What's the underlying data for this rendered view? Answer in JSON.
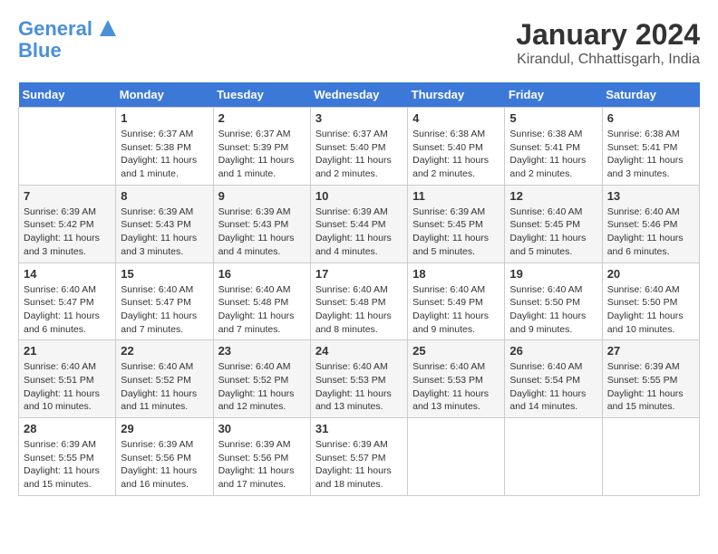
{
  "logo": {
    "line1": "General",
    "line2": "Blue"
  },
  "title": "January 2024",
  "location": "Kirandul, Chhattisgarh, India",
  "days_of_week": [
    "Sunday",
    "Monday",
    "Tuesday",
    "Wednesday",
    "Thursday",
    "Friday",
    "Saturday"
  ],
  "weeks": [
    [
      {
        "day": "",
        "info": ""
      },
      {
        "day": "1",
        "info": "Sunrise: 6:37 AM\nSunset: 5:38 PM\nDaylight: 11 hours\nand 1 minute."
      },
      {
        "day": "2",
        "info": "Sunrise: 6:37 AM\nSunset: 5:39 PM\nDaylight: 11 hours\nand 1 minute."
      },
      {
        "day": "3",
        "info": "Sunrise: 6:37 AM\nSunset: 5:40 PM\nDaylight: 11 hours\nand 2 minutes."
      },
      {
        "day": "4",
        "info": "Sunrise: 6:38 AM\nSunset: 5:40 PM\nDaylight: 11 hours\nand 2 minutes."
      },
      {
        "day": "5",
        "info": "Sunrise: 6:38 AM\nSunset: 5:41 PM\nDaylight: 11 hours\nand 2 minutes."
      },
      {
        "day": "6",
        "info": "Sunrise: 6:38 AM\nSunset: 5:41 PM\nDaylight: 11 hours\nand 3 minutes."
      }
    ],
    [
      {
        "day": "7",
        "info": "Sunrise: 6:39 AM\nSunset: 5:42 PM\nDaylight: 11 hours\nand 3 minutes."
      },
      {
        "day": "8",
        "info": "Sunrise: 6:39 AM\nSunset: 5:43 PM\nDaylight: 11 hours\nand 3 minutes."
      },
      {
        "day": "9",
        "info": "Sunrise: 6:39 AM\nSunset: 5:43 PM\nDaylight: 11 hours\nand 4 minutes."
      },
      {
        "day": "10",
        "info": "Sunrise: 6:39 AM\nSunset: 5:44 PM\nDaylight: 11 hours\nand 4 minutes."
      },
      {
        "day": "11",
        "info": "Sunrise: 6:39 AM\nSunset: 5:45 PM\nDaylight: 11 hours\nand 5 minutes."
      },
      {
        "day": "12",
        "info": "Sunrise: 6:40 AM\nSunset: 5:45 PM\nDaylight: 11 hours\nand 5 minutes."
      },
      {
        "day": "13",
        "info": "Sunrise: 6:40 AM\nSunset: 5:46 PM\nDaylight: 11 hours\nand 6 minutes."
      }
    ],
    [
      {
        "day": "14",
        "info": "Sunrise: 6:40 AM\nSunset: 5:47 PM\nDaylight: 11 hours\nand 6 minutes."
      },
      {
        "day": "15",
        "info": "Sunrise: 6:40 AM\nSunset: 5:47 PM\nDaylight: 11 hours\nand 7 minutes."
      },
      {
        "day": "16",
        "info": "Sunrise: 6:40 AM\nSunset: 5:48 PM\nDaylight: 11 hours\nand 7 minutes."
      },
      {
        "day": "17",
        "info": "Sunrise: 6:40 AM\nSunset: 5:48 PM\nDaylight: 11 hours\nand 8 minutes."
      },
      {
        "day": "18",
        "info": "Sunrise: 6:40 AM\nSunset: 5:49 PM\nDaylight: 11 hours\nand 9 minutes."
      },
      {
        "day": "19",
        "info": "Sunrise: 6:40 AM\nSunset: 5:50 PM\nDaylight: 11 hours\nand 9 minutes."
      },
      {
        "day": "20",
        "info": "Sunrise: 6:40 AM\nSunset: 5:50 PM\nDaylight: 11 hours\nand 10 minutes."
      }
    ],
    [
      {
        "day": "21",
        "info": "Sunrise: 6:40 AM\nSunset: 5:51 PM\nDaylight: 11 hours\nand 10 minutes."
      },
      {
        "day": "22",
        "info": "Sunrise: 6:40 AM\nSunset: 5:52 PM\nDaylight: 11 hours\nand 11 minutes."
      },
      {
        "day": "23",
        "info": "Sunrise: 6:40 AM\nSunset: 5:52 PM\nDaylight: 11 hours\nand 12 minutes."
      },
      {
        "day": "24",
        "info": "Sunrise: 6:40 AM\nSunset: 5:53 PM\nDaylight: 11 hours\nand 13 minutes."
      },
      {
        "day": "25",
        "info": "Sunrise: 6:40 AM\nSunset: 5:53 PM\nDaylight: 11 hours\nand 13 minutes."
      },
      {
        "day": "26",
        "info": "Sunrise: 6:40 AM\nSunset: 5:54 PM\nDaylight: 11 hours\nand 14 minutes."
      },
      {
        "day": "27",
        "info": "Sunrise: 6:39 AM\nSunset: 5:55 PM\nDaylight: 11 hours\nand 15 minutes."
      }
    ],
    [
      {
        "day": "28",
        "info": "Sunrise: 6:39 AM\nSunset: 5:55 PM\nDaylight: 11 hours\nand 15 minutes."
      },
      {
        "day": "29",
        "info": "Sunrise: 6:39 AM\nSunset: 5:56 PM\nDaylight: 11 hours\nand 16 minutes."
      },
      {
        "day": "30",
        "info": "Sunrise: 6:39 AM\nSunset: 5:56 PM\nDaylight: 11 hours\nand 17 minutes."
      },
      {
        "day": "31",
        "info": "Sunrise: 6:39 AM\nSunset: 5:57 PM\nDaylight: 11 hours\nand 18 minutes."
      },
      {
        "day": "",
        "info": ""
      },
      {
        "day": "",
        "info": ""
      },
      {
        "day": "",
        "info": ""
      }
    ]
  ],
  "stripe_colors": [
    "#ffffff",
    "#f5f5f5",
    "#ffffff",
    "#f5f5f5",
    "#ffffff"
  ]
}
